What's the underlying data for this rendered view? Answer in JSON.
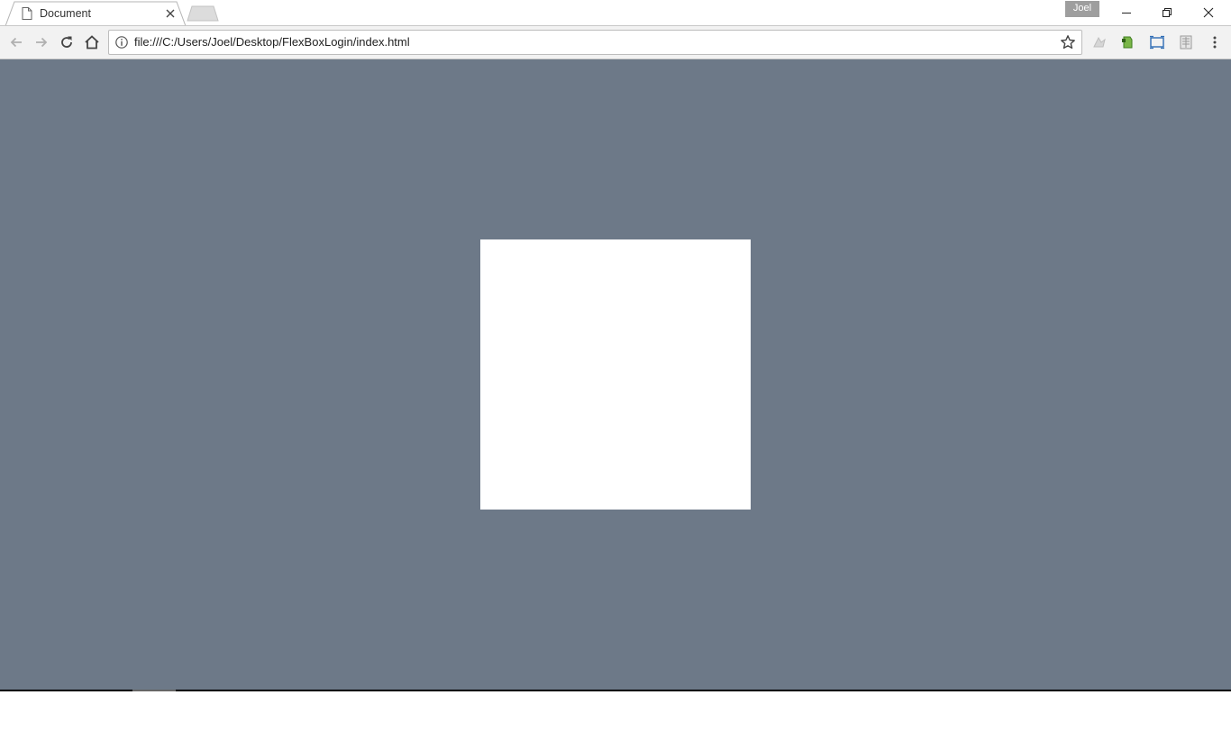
{
  "browser": {
    "tab": {
      "title": "Document",
      "favicon": "page-icon",
      "close_icon": "close-icon"
    },
    "new_tab_icon": "new-tab-icon",
    "profile": {
      "name": "Joel"
    },
    "window_controls": [
      "minimize-icon",
      "restore-icon",
      "close-icon"
    ],
    "toolbar": {
      "buttons": [
        "back-arrow-icon",
        "forward-arrow-icon",
        "reload-icon",
        "home-icon"
      ],
      "extensions": [
        "extension-icon",
        "evernote-icon",
        "screenshot-icon",
        "extension-grid-icon"
      ],
      "menu_icon": "kebab-menu-icon"
    },
    "omnibox": {
      "info_icon": "info-icon",
      "url": "file:///C:/Users/Joel/Desktop/FlexBoxLogin/index.html",
      "bookmark_icon": "star-icon"
    }
  },
  "page": {
    "background_color": "#6d7988",
    "card_color": "#ffffff"
  }
}
